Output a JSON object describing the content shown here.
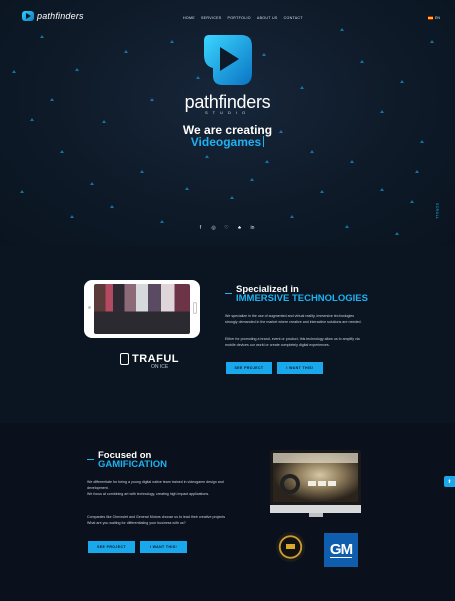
{
  "nav": {
    "logo_text": "pathfinders",
    "links": [
      "HOME",
      "SERVICES",
      "PORTFOLIO",
      "ABOUT US",
      "CONTACT"
    ],
    "language": "EN"
  },
  "hero": {
    "brand": "pathfinders",
    "brand_sub": "STUDIO",
    "headline": "We are creating",
    "rotating_word": "Videogames",
    "social_icons": [
      "facebook-icon",
      "instagram-icon",
      "twitter-icon",
      "vine-icon",
      "linkedin-icon"
    ],
    "social_glyphs": [
      "f",
      "◎",
      "♡",
      "♣",
      "in"
    ],
    "side_label": "SCROLL"
  },
  "immersive": {
    "heading_1": "Specialized in",
    "heading_2": "IMMERSIVE TECHNOLOGIES",
    "p1_line1": "We specialize in the use of augmented and virtual reality, immersive technologies",
    "p1_line2": "strongly demanded in the market where creative and interactive solutions are needed.",
    "p2_line1": "Either for promoting a brand, event or product, this technology allow us to amplify via",
    "p2_line2": "mobile devices our world or create completely digital experiences.",
    "btn_see": "SEE PROJECT",
    "btn_want": "I WANT THIS!",
    "client_name": "TRAFUL",
    "client_sub": "ON ICE"
  },
  "gamification": {
    "heading_1": "Focused on",
    "heading_2": "GAMIFICATION",
    "p1_line1": "We differentiate for being a young digital native team trained in videogame design and",
    "p1_line2": "development.",
    "p1_line3": "We focus at combining art with technology, creating high impact applications.",
    "p2_line1": "Companies like Chevrolet and General Motors choose us to lead their creative projects",
    "p2_line2": "What are you waiting for differentiating your business with us?",
    "btn_see": "SEE PROJECT",
    "btn_want": "I WANT THIS!",
    "gm_logo": "GM"
  },
  "colors": {
    "accent": "#1eb2f2",
    "bg_dark": "#0b1521",
    "bg_darker": "#0a111c"
  }
}
